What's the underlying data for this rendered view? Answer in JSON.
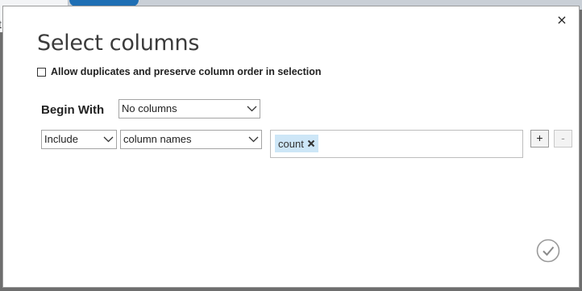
{
  "background": {
    "tab_letter": "t"
  },
  "dialog": {
    "close_label": "×",
    "title": "Select columns",
    "duplicates_checkbox": {
      "label": "Allow duplicates and preserve column order in selection",
      "checked": false
    },
    "begin_with": {
      "label": "Begin With",
      "value": "No columns"
    },
    "rule": {
      "mode": "Include",
      "by": "column names",
      "selected_columns": [
        "count"
      ],
      "add_label": "+",
      "remove_label": "-"
    }
  },
  "colors": {
    "tag_bg": "#cde6f7",
    "ok_circle": "#9a9a9a"
  }
}
